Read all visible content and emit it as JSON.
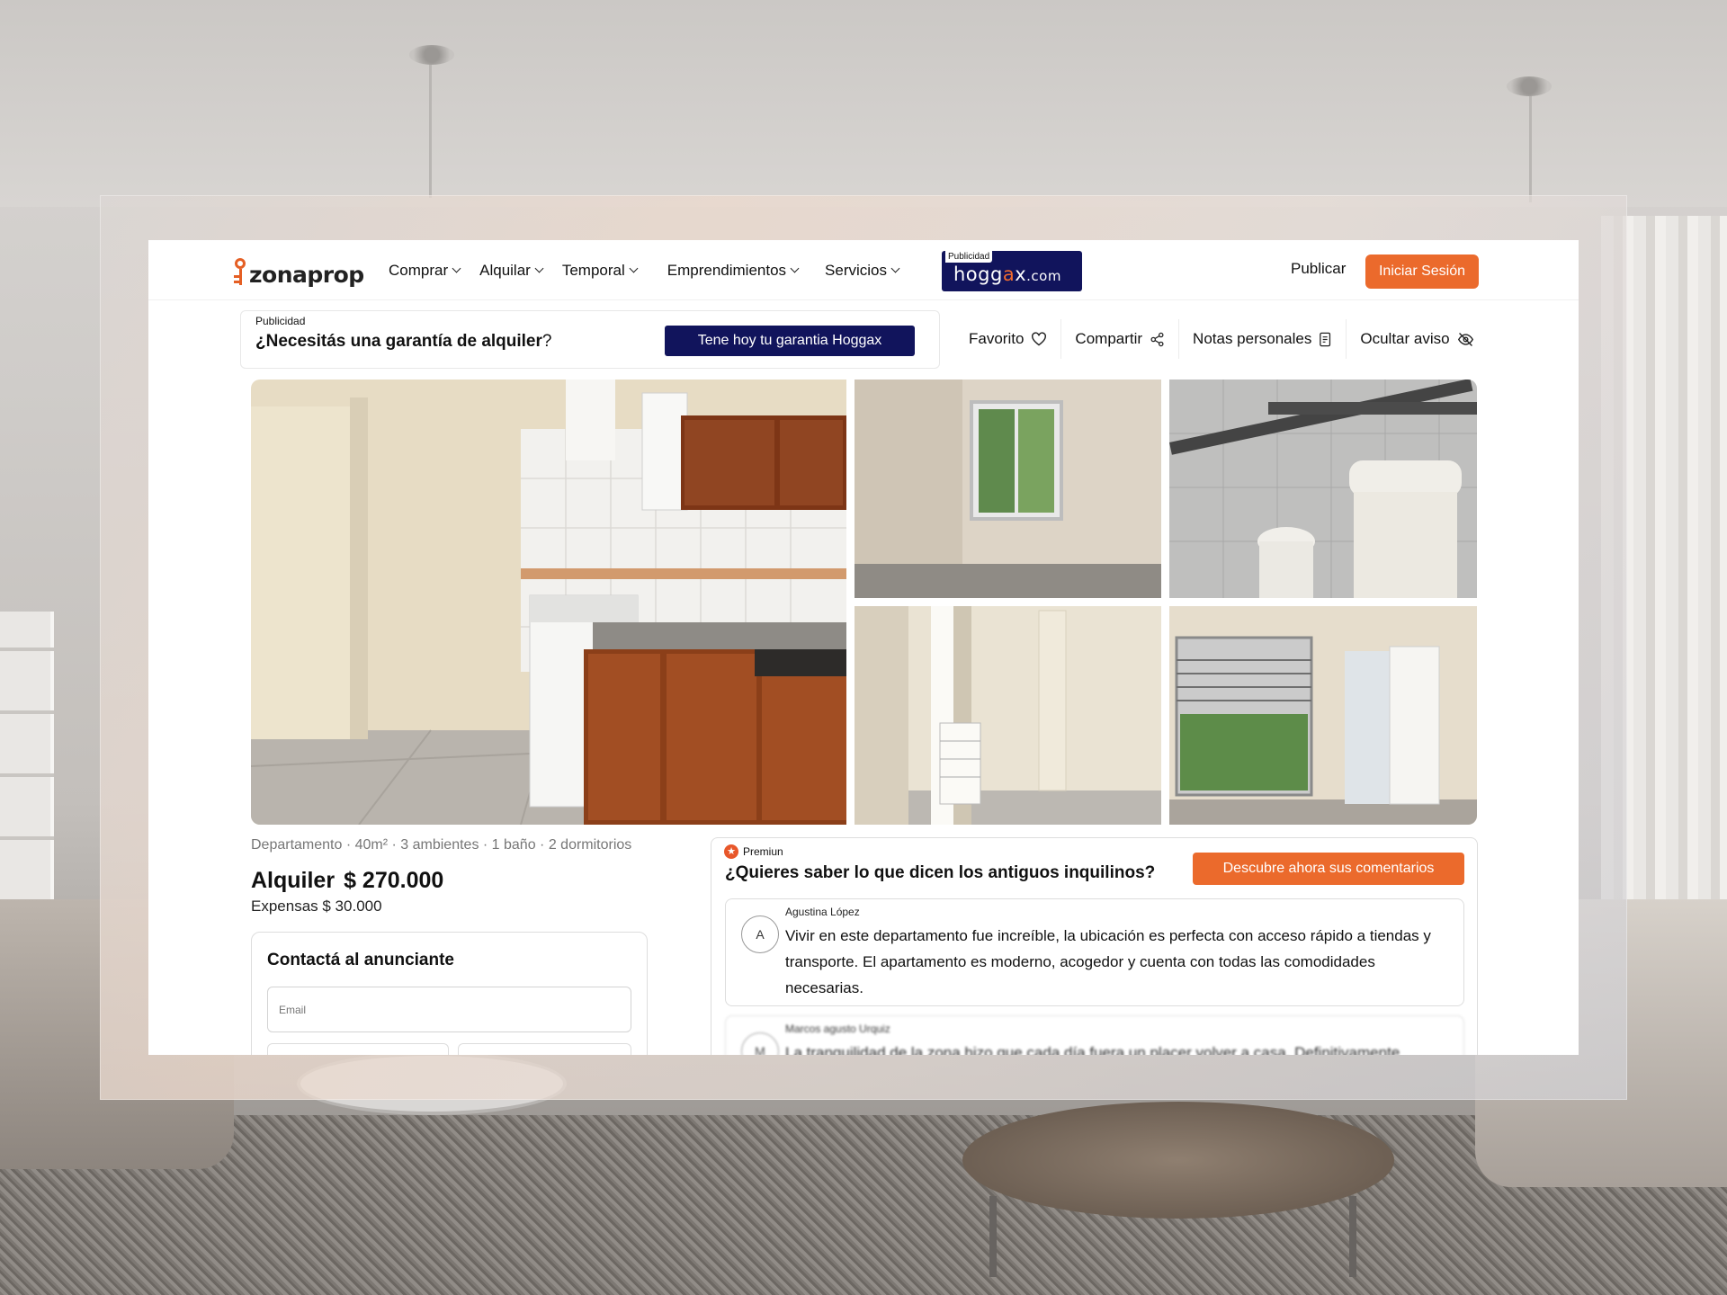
{
  "nav": {
    "logo": "zonaprop",
    "menu": [
      "Comprar",
      "Alquilar",
      "Temporal",
      "Emprendimientos",
      "Servicios"
    ],
    "ad_tag": "Publicidad",
    "ad_brand_pre": "hogg",
    "ad_brand_o": "a",
    "ad_brand_post": "x",
    "ad_brand_tld": ".com",
    "publicar": "Publicar",
    "login": "Iniciar Sesión"
  },
  "banner": {
    "label": "Publicidad",
    "question": "¿Necesitás una garantía de alquiler",
    "question_mark": "?",
    "cta": "Tene hoy tu garantia Hoggax"
  },
  "actions": {
    "favorite": "Favorito",
    "share": "Compartir",
    "notes": "Notas personales",
    "hide": "Ocultar aviso"
  },
  "listing": {
    "features": "Departamento · 40m² · 3 ambientes · 1 baño · 2 dormitorios",
    "operation": "Alquiler",
    "price": "$ 270.000",
    "expensas": "Expensas $ 30.000"
  },
  "contact": {
    "title": "Contactá al anunciante",
    "email_placeholder": "Email"
  },
  "premium": {
    "badge": "Premiun",
    "title": "¿Quieres saber lo que dicen los antiguos inquilinos?",
    "cta": "Descubre ahora sus comentarios",
    "reviews": [
      {
        "initial": "A",
        "name": "Agustina López",
        "text": "Vivir en este departamento fue increíble, la ubicación es perfecta con acceso rápido a tiendas y transporte. El apartamento es moderno, acogedor y cuenta con todas las comodidades necesarias."
      },
      {
        "initial": "M",
        "name": "Marcos agusto Urquiz",
        "text": "La tranquilidad de la zona hizo que cada día fuera un placer volver a casa. Definitivamente"
      }
    ]
  },
  "colors": {
    "accent": "#eb6a2c",
    "hoggax_navy": "#11145c"
  }
}
